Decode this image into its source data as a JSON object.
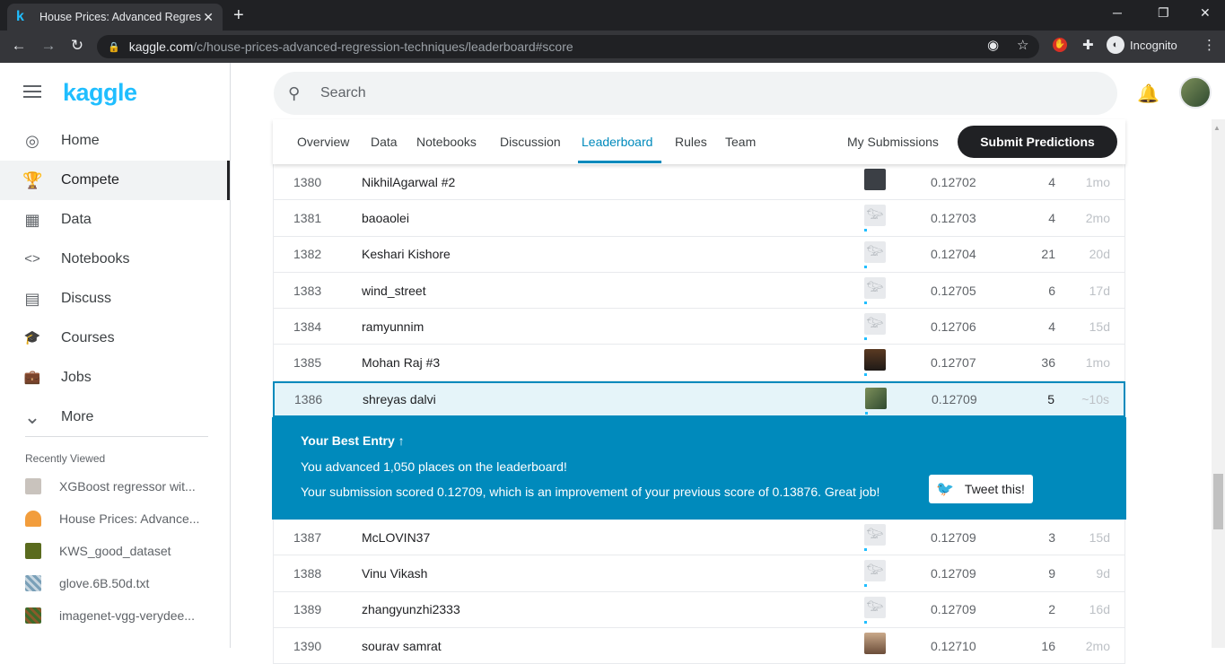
{
  "browser": {
    "tab_favicon": "k",
    "tab_title": "House Prices: Advanced Regressi",
    "tab_close": "✕",
    "new_tab": "+",
    "url_host": "kaggle.com",
    "url_path": "/c/house-prices-advanced-regression-techniques/leaderboard#score",
    "incognito_label": "Incognito"
  },
  "sidebar": {
    "logo": "kaggle",
    "items": [
      {
        "label": "Home",
        "icon": "compass-icon",
        "glyph": "◎"
      },
      {
        "label": "Compete",
        "icon": "trophy-icon",
        "glyph": "🏆"
      },
      {
        "label": "Data",
        "icon": "table-icon",
        "glyph": "▦"
      },
      {
        "label": "Notebooks",
        "icon": "code-icon",
        "glyph": "<>"
      },
      {
        "label": "Discuss",
        "icon": "comment-icon",
        "glyph": "▤"
      },
      {
        "label": "Courses",
        "icon": "graduation-cap-icon",
        "glyph": "🎓"
      },
      {
        "label": "Jobs",
        "icon": "briefcase-icon",
        "glyph": "💼"
      },
      {
        "label": "More",
        "icon": "chevron-down-icon",
        "glyph": "⌄"
      }
    ],
    "active": "Compete",
    "recent_heading": "Recently Viewed",
    "recent": [
      {
        "label": "XGBoost regressor wit...",
        "color": "#c9c3bd"
      },
      {
        "label": "House Prices: Advance...",
        "color": "#f29d3c"
      },
      {
        "label": "KWS_good_dataset",
        "color": "#5a6b1e"
      },
      {
        "label": "glove.6B.50d.txt",
        "color": "#7aa0b8"
      },
      {
        "label": "imagenet-vgg-verydee...",
        "color": "#3e6b2a"
      }
    ]
  },
  "header": {
    "search_placeholder": "Search"
  },
  "competition_tabs": [
    "Overview",
    "Data",
    "Notebooks",
    "Discussion",
    "Leaderboard",
    "Rules",
    "Team"
  ],
  "active_tab": "Leaderboard",
  "my_submissions": "My Submissions",
  "submit_button": "Submit Predictions",
  "leaderboard": {
    "rows_before": [
      {
        "rank": "1380",
        "team": "NikhilAgarwal #2",
        "score": "0.12702",
        "entries": "4",
        "last": "1mo",
        "photo": true
      },
      {
        "rank": "1381",
        "team": "baoaolei",
        "score": "0.12703",
        "entries": "4",
        "last": "2mo",
        "photo": false
      },
      {
        "rank": "1382",
        "team": "Keshari Kishore",
        "score": "0.12704",
        "entries": "21",
        "last": "20d",
        "photo": false
      },
      {
        "rank": "1383",
        "team": "wind_street",
        "score": "0.12705",
        "entries": "6",
        "last": "17d",
        "photo": false
      },
      {
        "rank": "1384",
        "team": "ramyunnim",
        "score": "0.12706",
        "entries": "4",
        "last": "15d",
        "photo": false
      },
      {
        "rank": "1385",
        "team": "Mohan Raj #3",
        "score": "0.12707",
        "entries": "36",
        "last": "1mo",
        "photo": true
      }
    ],
    "my_row": {
      "rank": "1386",
      "team": "shreyas dalvi",
      "score": "0.12709",
      "entries": "5",
      "last": "~10s",
      "photo": true
    },
    "best_entry": {
      "title": "Your Best Entry ↑",
      "line1": "You advanced 1,050 places on the leaderboard!",
      "line2": "Your submission scored 0.12709, which is an improvement of your previous score of 0.13876. Great job!",
      "tweet": "Tweet this!"
    },
    "rows_after": [
      {
        "rank": "1387",
        "team": "McLOVIN37",
        "score": "0.12709",
        "entries": "3",
        "last": "15d",
        "photo": false
      },
      {
        "rank": "1388",
        "team": "Vinu Vikash",
        "score": "0.12709",
        "entries": "9",
        "last": "9d",
        "photo": false
      },
      {
        "rank": "1389",
        "team": "zhangyunzhi2333",
        "score": "0.12709",
        "entries": "2",
        "last": "16d",
        "photo": false
      },
      {
        "rank": "1390",
        "team": "sourav samrat",
        "score": "0.12710",
        "entries": "16",
        "last": "2mo",
        "photo": true
      }
    ]
  },
  "colors": {
    "brand": "#20beff",
    "accent": "#008abc",
    "dark": "#202124"
  }
}
